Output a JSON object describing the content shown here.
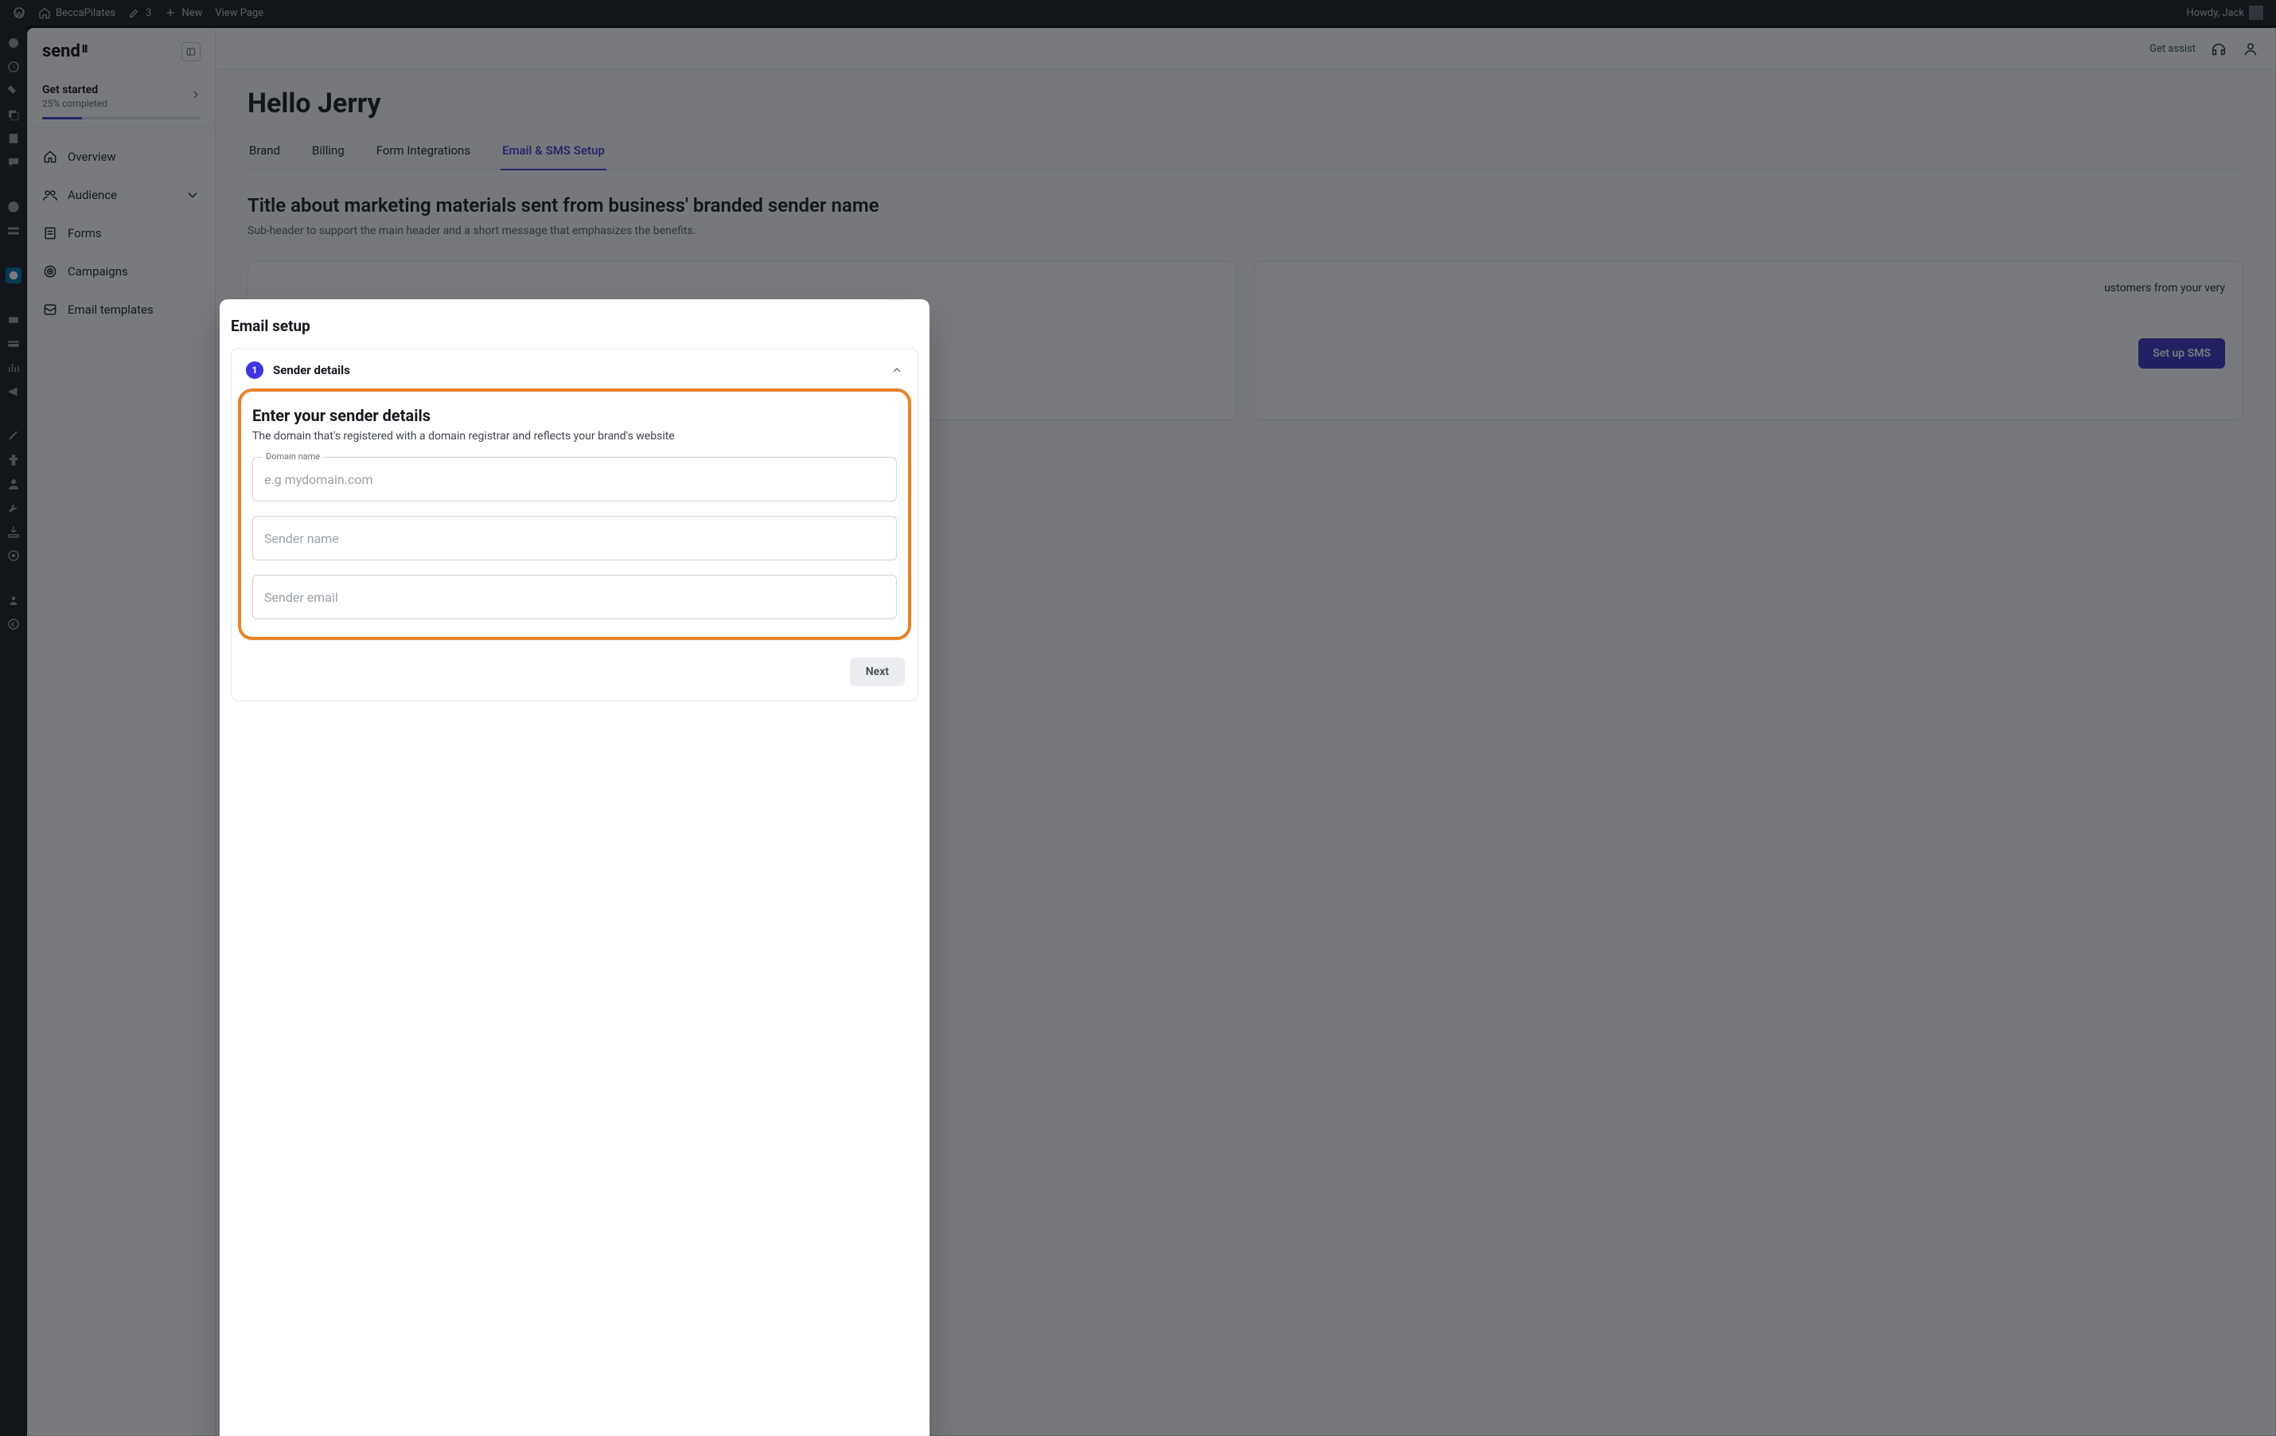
{
  "wpbar": {
    "site_name": "BeccaPilates",
    "pending_count": "3",
    "new_label": "New",
    "view_page": "View Page",
    "howdy": "Howdy, Jack"
  },
  "brand": {
    "name": "send",
    "mark": "II"
  },
  "get_started": {
    "title": "Get started",
    "subtitle": "25% completed",
    "progress_percent": 25
  },
  "sidebar_items": [
    {
      "icon": "home",
      "label": "Overview"
    },
    {
      "icon": "audience",
      "label": "Audience",
      "has_children": true
    },
    {
      "icon": "forms",
      "label": "Forms"
    },
    {
      "icon": "campaigns",
      "label": "Campaigns"
    },
    {
      "icon": "templates",
      "label": "Email templates"
    }
  ],
  "topbar": {
    "get_assist": "Get assist"
  },
  "main": {
    "hello": "Hello Jerry",
    "tabs": [
      {
        "label": "Brand"
      },
      {
        "label": "Billing"
      },
      {
        "label": "Form Integrations"
      },
      {
        "label": "Email & SMS Setup",
        "active": true
      }
    ],
    "section_title": "Title about marketing materials sent from business' branded sender name",
    "section_sub": "Sub-header to support the main header and a short message that emphasizes the benefits.",
    "sms_card_text": "ustomers from your very",
    "sms_cta": "Set up SMS"
  },
  "modal": {
    "title": "Email setup",
    "step_number": "1",
    "step_label": "Sender details",
    "panel": {
      "heading": "Enter your sender details",
      "sub": "The domain that's registered with a domain registrar and reflects your brand's website",
      "domain_label": "Domain name",
      "domain_placeholder": "e.g mydomain.com",
      "sender_name_placeholder": "Sender name",
      "sender_email_placeholder": "Sender email"
    },
    "next": "Next"
  }
}
